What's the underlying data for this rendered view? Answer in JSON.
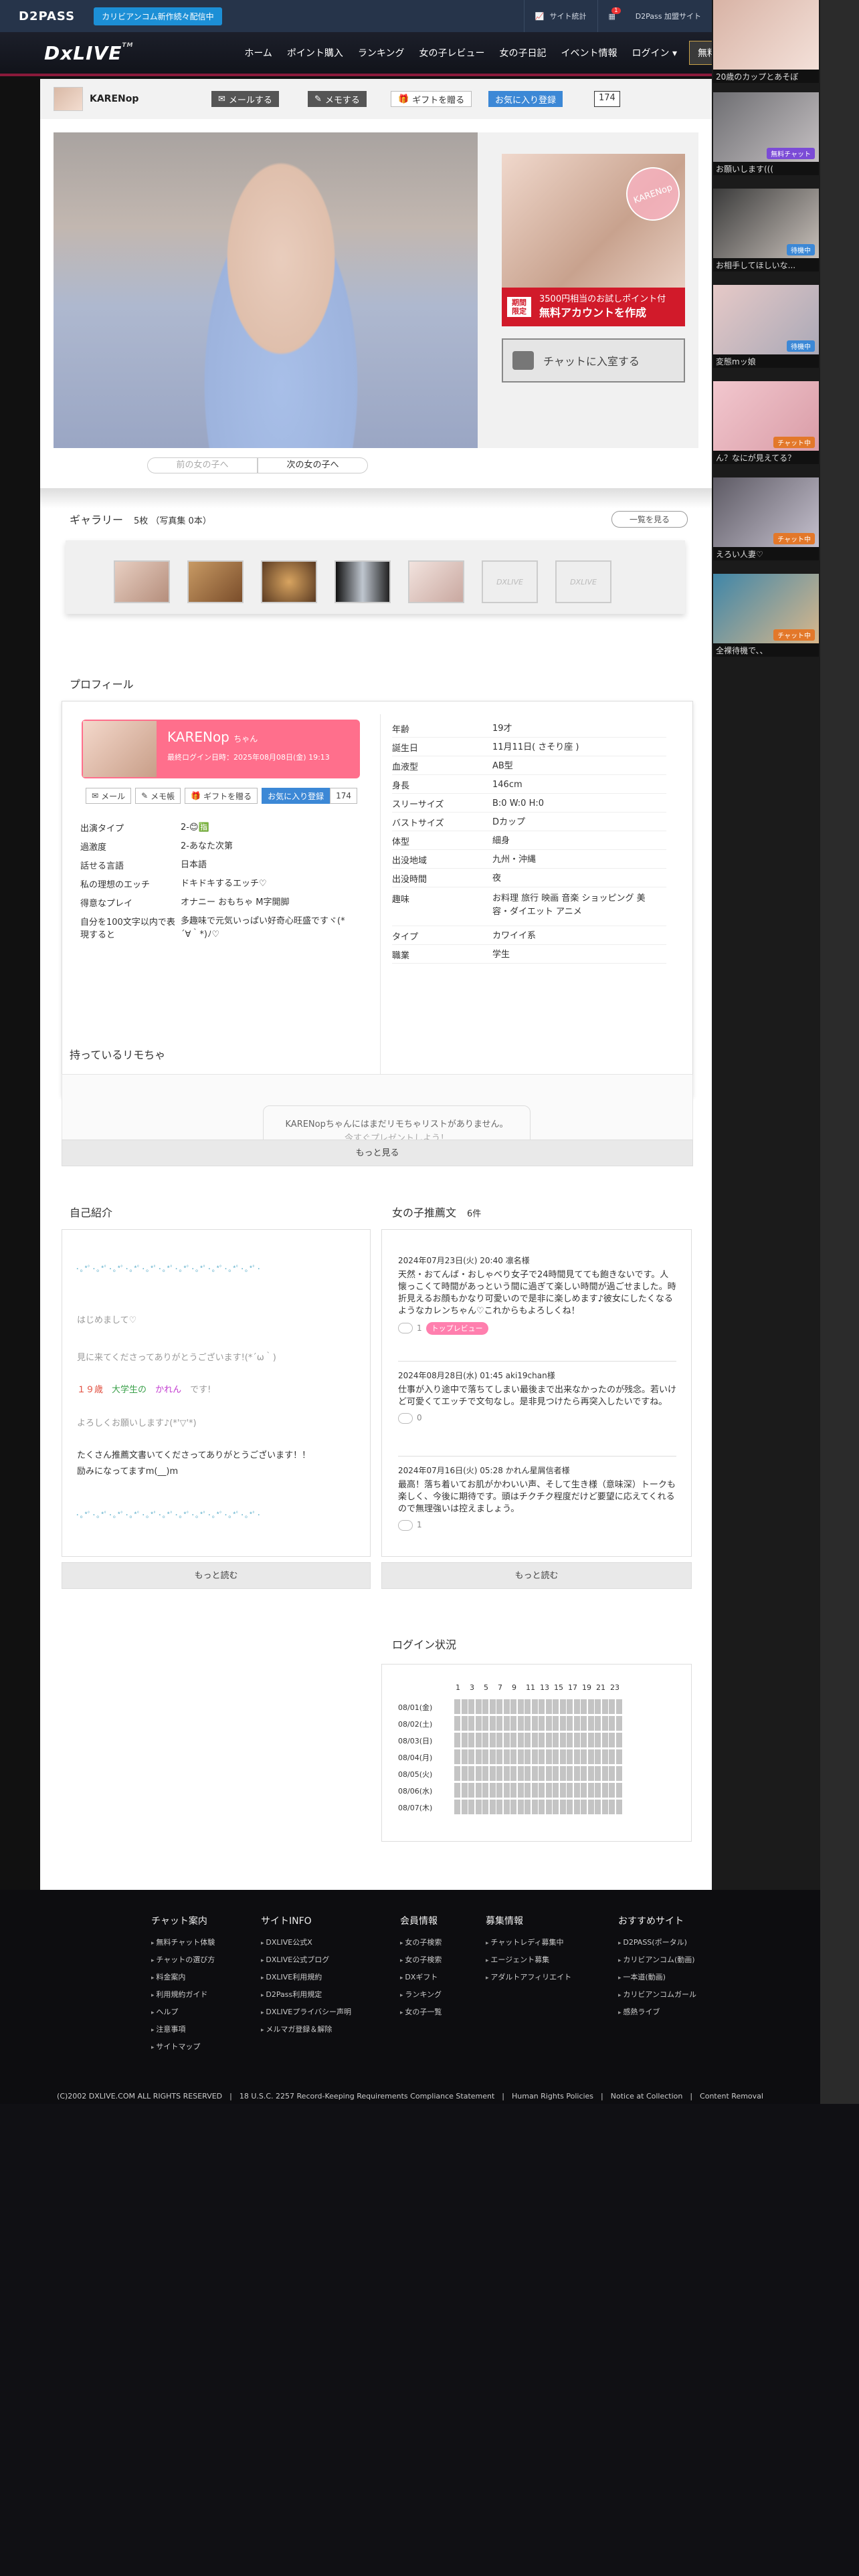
{
  "topbar": {
    "logo": "D2PASS",
    "promo": "カリビアンコム新作続々配信中",
    "site_stats": "サイト統計",
    "d2pass_sites": "D2Pass 加盟サイト",
    "info": "情報",
    "notif": "1"
  },
  "nav": {
    "brand": "DxLIVE",
    "brand_tm": "TM",
    "items": [
      "ホーム",
      "ポイント購入",
      "ランキング",
      "女の子レビュー",
      "女の子日記",
      "イベント情報",
      "ログイン ▾"
    ],
    "free_btn": "無料アカウントを作成"
  },
  "rail": [
    {
      "caption": "20歳のカップとあそぼ",
      "tag": "",
      "tag_color": "",
      "g1": "#d8b3a5",
      "g2": "#f5e3dc"
    },
    {
      "caption": "お願いします(((",
      "tag": "無料チャット",
      "tag_color": "#7b4bd6",
      "g1": "#6e6e72",
      "g2": "#c9c4c6"
    },
    {
      "caption": "お相手してほしいな...",
      "tag": "待機中",
      "tag_color": "#3c88d6",
      "g1": "#3b3b3b",
      "g2": "#cfc7c0"
    },
    {
      "caption": "変態mッ娘",
      "tag": "待機中",
      "tag_color": "#3c88d6",
      "g1": "#e6c9c7",
      "g2": "#a7a7b6"
    },
    {
      "caption": "ん？なにが見えてる？",
      "tag": "チャット中",
      "tag_color": "#e3782a",
      "g1": "#f2c7ce",
      "g2": "#d89aa5"
    },
    {
      "caption": "えろい人妻♡",
      "tag": "チャット中",
      "tag_color": "#e3782a",
      "g1": "#5d5a64",
      "g2": "#cbc6d4"
    },
    {
      "caption": "全裸待機で、、",
      "tag": "チャット中",
      "tag_color": "#e3782a",
      "g1": "#3f86a8",
      "g2": "#e1ba8a"
    }
  ],
  "header": {
    "name": "KARENop",
    "mail": "メールする",
    "memo": "メモする",
    "gift": "ギフトを贈る",
    "fav": "お気に入り登録",
    "fav_count": "174"
  },
  "side": {
    "circle": "KARENop",
    "cta_label": "期間限定",
    "cta_line1": "3500円相当のお試しポイント付",
    "cta_line2": "無料アカウントを作成",
    "chat": "チャットに入室する"
  },
  "pager": {
    "prev": "前の女の子へ",
    "next": "次の女の子へ"
  },
  "gallery": {
    "title": "ギャラリー",
    "count": "5枚 （写真集 0本）",
    "more": "一覧を見る",
    "dx_label": "DXLIVE"
  },
  "profile": {
    "title": "プロフィール",
    "name": "KARENop",
    "honorific": "ちゃん",
    "last_login": "最終ログイン日時：2025年08月08日(金) 19:13",
    "mail": "メール",
    "memo": "メモ帳",
    "gift": "ギフトを贈る",
    "fav": "お気に入り登録",
    "fav_count": "174",
    "left": [
      [
        "出演タイプ",
        "2-😊🈯"
      ],
      [
        "過激度",
        "2-あなた次第"
      ],
      [
        "話せる言語",
        "日本語"
      ],
      [
        "私の理想のエッチ",
        "ドキドキするエッチ♡"
      ],
      [
        "得意なプレイ",
        "オナニー おもちゃ M字開脚"
      ],
      [
        "自分を100文字以内で表現すると",
        "多趣味で元気いっぱい好奇心旺盛ですヾ(*´∀｀*)ﾉ♡"
      ]
    ],
    "right": [
      [
        "年齢",
        "19才"
      ],
      [
        "誕生日",
        "11月11日( さそり座 )"
      ],
      [
        "血液型",
        "AB型"
      ],
      [
        "身長",
        "146cm"
      ],
      [
        "スリーサイズ",
        "B:0 W:0 H:0"
      ],
      [
        "バストサイズ",
        "Dカップ"
      ],
      [
        "体型",
        "細身"
      ],
      [
        "出没地域",
        "九州・沖縄"
      ],
      [
        "出没時間",
        "夜"
      ],
      [
        "趣味",
        "お料理 旅行 映画 音楽 ショッピング 美容・ダイエット アニメ"
      ],
      [
        "タイプ",
        "カワイイ系"
      ],
      [
        "職業",
        "学生"
      ]
    ]
  },
  "remo": {
    "title": "持っているリモちゃ",
    "msg1": "KARENopちゃんにはまだリモちゃリストがありません。",
    "msg2": "今すぐプレゼントしよう！",
    "more": "もっと見る"
  },
  "intro": {
    "title": "自己紹介",
    "deco": "･｡*ﾟ･｡*ﾟ･｡*ﾟ･｡*ﾟ･｡*ﾟ･｡*ﾟ･｡*ﾟ･｡*ﾟ･｡*ﾟ･｡*ﾟ･｡*ﾟ･",
    "l1": "はじめまして♡",
    "l2": "見に来てくださってありがとうございます!(*´ω｀)",
    "age": "１９歳",
    "student": "大学生の",
    "karen": "かれん",
    "desu": "です!",
    "l4": "よろしくお願いします♪(*'▽'*)",
    "l5": "たくさん推薦文書いてくださってありがとうございます！！",
    "l6": "励みになってますm(__)m",
    "more": "もっと読む"
  },
  "rec": {
    "title": "女の子推薦文",
    "count": "6件",
    "more": "もっと読む",
    "items": [
      {
        "date": "2024年07月23日(火) 20:40  凛名様",
        "text": "天然・おてんば・おしゃべり女子で24時間見てても飽きないです。人懐っこくて時間があっという間に過ぎて楽しい時間が過ごせました。時折見えるお顔もかなり可愛いので是非に楽しめます♪彼女にしたくなるようなカレンちゃん♡これからもよろしくね！",
        "likes": "1",
        "badge": "トップレビュー"
      },
      {
        "date": "2024年08月28日(水) 01:45  aki19chan様",
        "text": "仕事が入り途中で落ちてしまい最後まで出来なかったのが残念。若いけど可愛くてエッチで文句なし。是非見つけたら再突入したいですね。",
        "likes": "0",
        "badge": ""
      },
      {
        "date": "2024年07月16日(火) 05:28  かれん星屑信者様",
        "text": "最高！落ち着いてお肌がかわいい声、そして生き様（意味深）トークも楽しく、今後に期待です。頭はチクチク程度だけど要望に応えてくれるので無理強いは控えましょう。",
        "likes": "1",
        "badge": ""
      }
    ]
  },
  "login": {
    "title": "ログイン状況",
    "hours": [
      "1",
      "3",
      "5",
      "7",
      "9",
      "11",
      "13",
      "15",
      "17",
      "19",
      "21",
      "23"
    ],
    "days": [
      "08/01(金)",
      "08/02(土)",
      "08/03(日)",
      "08/04(月)",
      "08/05(火)",
      "08/06(水)",
      "08/07(木)"
    ]
  },
  "footer": {
    "cols": [
      {
        "title": "チャット案内",
        "items": [
          "無料チャット体験",
          "チャットの選び方",
          "料金案内",
          "利用規約ガイド",
          "ヘルプ",
          "注意事項",
          "サイトマップ"
        ]
      },
      {
        "title": "サイトINFO",
        "items": [
          "DXLIVE公式X",
          "DXLIVE公式ブログ",
          "DXLIVE利用規約",
          "D2Pass利用規定",
          "DXLIVEプライバシー声明",
          "メルマガ登録＆解除"
        ]
      },
      {
        "title": "会員情報",
        "items": [
          "女の子検索",
          "女の子検索",
          "DXギフト",
          "ランキング",
          "女の子一覧"
        ]
      },
      {
        "title": "募集情報",
        "items": [
          "チャットレディ募集中",
          "エージェント募集",
          "アダルトアフィリエイト"
        ]
      },
      {
        "title": "おすすめサイト",
        "items": [
          "D2PASS(ポータル)",
          "カリビアンコム(動画)",
          "一本道(動画)",
          "カリビアンコムガール",
          "感熱ライブ"
        ]
      }
    ],
    "bottom": "(C)2002 DXLIVE.COM ALL RIGHTS RESERVED　|　18 U.S.C. 2257 Record-Keeping Requirements Compliance Statement　|　Human Rights Policies　|　Notice at Collection　|　Content Removal"
  }
}
